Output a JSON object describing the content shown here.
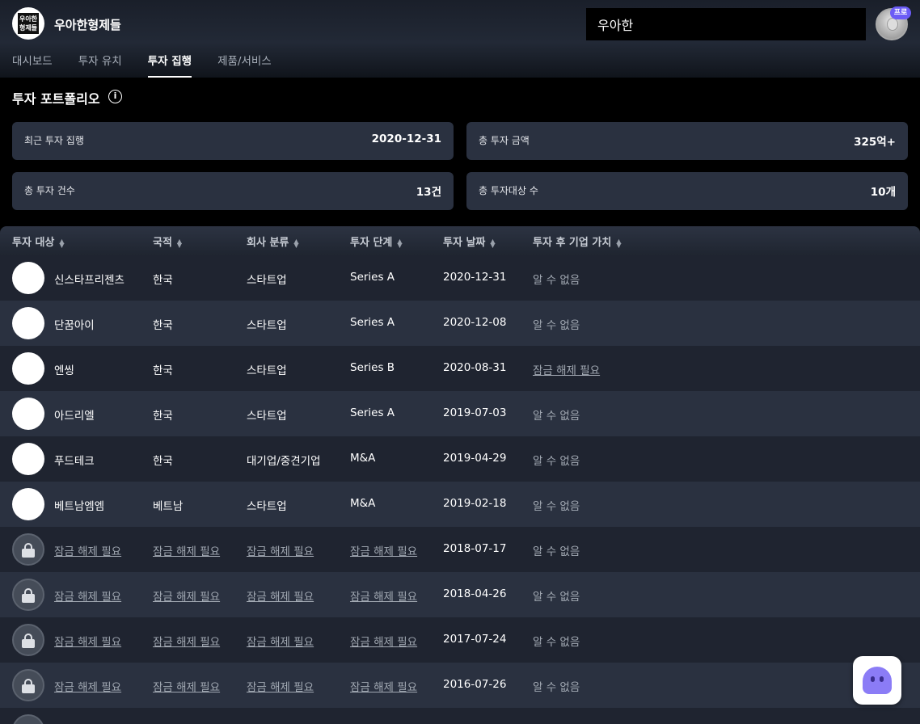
{
  "header": {
    "logo_text": "우아한형제들",
    "company_name": "우아한형제들",
    "search_value": "우아한",
    "pro_badge": "프로"
  },
  "tabs": [
    {
      "label": "대시보드",
      "active": false
    },
    {
      "label": "투자 유치",
      "active": false
    },
    {
      "label": "투자 집행",
      "active": true
    },
    {
      "label": "제품/서비스",
      "active": false
    }
  ],
  "section": {
    "title": "투자 포트폴리오",
    "info_glyph": "i"
  },
  "stats": [
    {
      "label": "최근 투자 집행",
      "value": "2020-12-31"
    },
    {
      "label": "총 투자 금액",
      "value": "325억+"
    },
    {
      "label": "총 투자 건수",
      "value": "13건"
    },
    {
      "label": "총 투자대상 수",
      "value": "10개"
    }
  ],
  "table": {
    "columns": [
      "투자 대상",
      "국적",
      "회사 분류",
      "투자 단계",
      "투자 날짜",
      "투자 후 기업 가치"
    ],
    "rows": [
      {
        "logo": "company-logo",
        "name": "신스타프리젠츠",
        "country": "한국",
        "type": "스타트업",
        "stage": "Series A",
        "date": "2020-12-31",
        "value": "알 수 없음",
        "locked": false,
        "value_locked": false
      },
      {
        "logo": "company-logo",
        "name": "단꿈아이",
        "country": "한국",
        "type": "스타트업",
        "stage": "Series A",
        "date": "2020-12-08",
        "value": "알 수 없음",
        "locked": false,
        "value_locked": false
      },
      {
        "logo": "company-logo",
        "name": "엔씽",
        "country": "한국",
        "type": "스타트업",
        "stage": "Series B",
        "date": "2020-08-31",
        "value": "잠금 해제 필요",
        "locked": false,
        "value_locked": true
      },
      {
        "logo": "company-logo",
        "name": "아드리엘",
        "country": "한국",
        "type": "스타트업",
        "stage": "Series A",
        "date": "2019-07-03",
        "value": "알 수 없음",
        "locked": false,
        "value_locked": false
      },
      {
        "logo": "company-logo",
        "name": "푸드테크",
        "country": "한국",
        "type": "대기업/중견기업",
        "stage": "M&A",
        "date": "2019-04-29",
        "value": "알 수 없음",
        "locked": false,
        "value_locked": false
      },
      {
        "logo": "company-logo",
        "name": "베트남엠엠",
        "country": "베트남",
        "type": "스타트업",
        "stage": "M&A",
        "date": "2019-02-18",
        "value": "알 수 없음",
        "locked": false,
        "value_locked": false
      },
      {
        "logo": "lock-icon",
        "name": "잠금 해제 필요",
        "country": "잠금 해제 필요",
        "type": "잠금 해제 필요",
        "stage": "잠금 해제 필요",
        "date": "2018-07-17",
        "value": "알 수 없음",
        "locked": true,
        "value_locked": false
      },
      {
        "logo": "lock-icon",
        "name": "잠금 해제 필요",
        "country": "잠금 해제 필요",
        "type": "잠금 해제 필요",
        "stage": "잠금 해제 필요",
        "date": "2018-04-26",
        "value": "알 수 없음",
        "locked": true,
        "value_locked": false
      },
      {
        "logo": "lock-icon",
        "name": "잠금 해제 필요",
        "country": "잠금 해제 필요",
        "type": "잠금 해제 필요",
        "stage": "잠금 해제 필요",
        "date": "2017-07-24",
        "value": "알 수 없음",
        "locked": true,
        "value_locked": false
      },
      {
        "logo": "lock-icon",
        "name": "잠금 해제 필요",
        "country": "잠금 해제 필요",
        "type": "잠금 해제 필요",
        "stage": "잠금 해제 필요",
        "date": "2016-07-26",
        "value": "알 수 없음",
        "locked": true,
        "value_locked": false
      },
      {
        "logo": "lock-icon",
        "name": "",
        "country": "",
        "type": "",
        "stage": "",
        "date": "",
        "value": "",
        "locked": true,
        "value_locked": false
      }
    ]
  },
  "colors": {
    "row_odd": "#1f2430",
    "row_even": "#2a3140",
    "card": "#2a3140",
    "accent": "#6b5cf6"
  }
}
